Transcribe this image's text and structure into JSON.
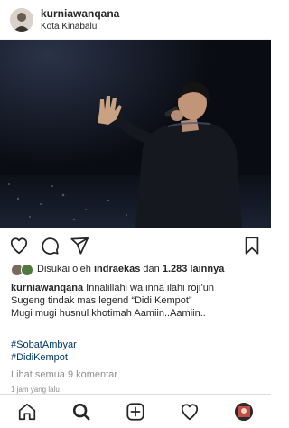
{
  "post": {
    "username": "kurniawanqana",
    "location": "Kota Kinabalu",
    "likes": {
      "prefix": "Disukai oleh",
      "liker": "indraekas",
      "conjunction": "dan",
      "others": "1.283 lainnya"
    },
    "caption": {
      "username": "kurniawanqana",
      "line1": "Innalillahi wa inna ilahi roji’un",
      "line2": "Sugeng tindak mas legend “Didi Kempot”",
      "line3": "Mugi mugi husnul khotimah Aamiin..Aamiin.."
    },
    "hashtags": [
      "#SobatAmbyar",
      "#DidiKempot"
    ],
    "view_comments": "Lihat semua 9 komentar",
    "time_ago": "1 jam yang lalu"
  },
  "icons": {
    "like": "heart-icon",
    "comment": "comment-icon",
    "share": "send-icon",
    "save": "bookmark-icon"
  },
  "nav": {
    "home": "home-icon",
    "search": "search-icon",
    "create": "new-post-icon",
    "activity": "heart-icon",
    "profile": "profile-avatar"
  },
  "colors": {
    "text": "#262626",
    "hashtag": "#00376b",
    "muted": "#8e8e8e",
    "divider": "#dbdbdb"
  }
}
